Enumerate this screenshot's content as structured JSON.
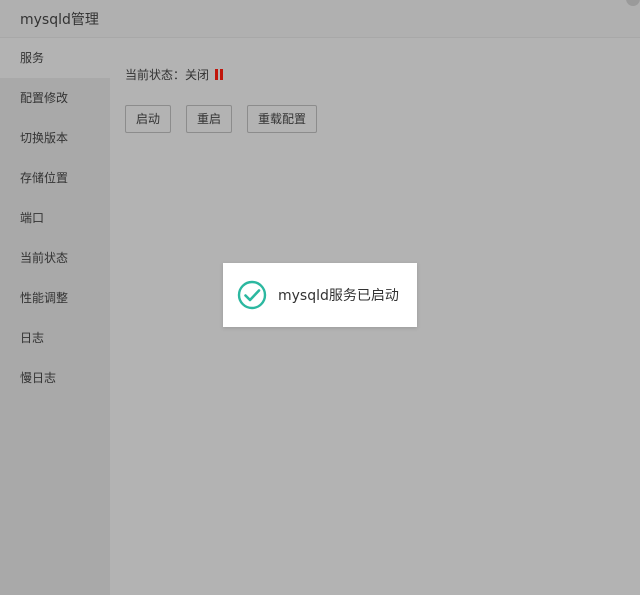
{
  "window": {
    "title": "mysqld管理"
  },
  "sidebar": {
    "items": [
      {
        "label": "服务"
      },
      {
        "label": "配置修改"
      },
      {
        "label": "切换版本"
      },
      {
        "label": "存储位置"
      },
      {
        "label": "端口"
      },
      {
        "label": "当前状态"
      },
      {
        "label": "性能调整"
      },
      {
        "label": "日志"
      },
      {
        "label": "慢日志"
      }
    ]
  },
  "main": {
    "status_label": "当前状态：",
    "status_value": "关闭",
    "status_icon": "pause-icon",
    "status_color": "#c0150a",
    "buttons": {
      "start": "启动",
      "restart": "重启",
      "reload": "重载配置"
    }
  },
  "toast": {
    "icon": "check-circle-icon",
    "icon_color": "#2cb8a0",
    "message": "mysqld服务已启动"
  }
}
